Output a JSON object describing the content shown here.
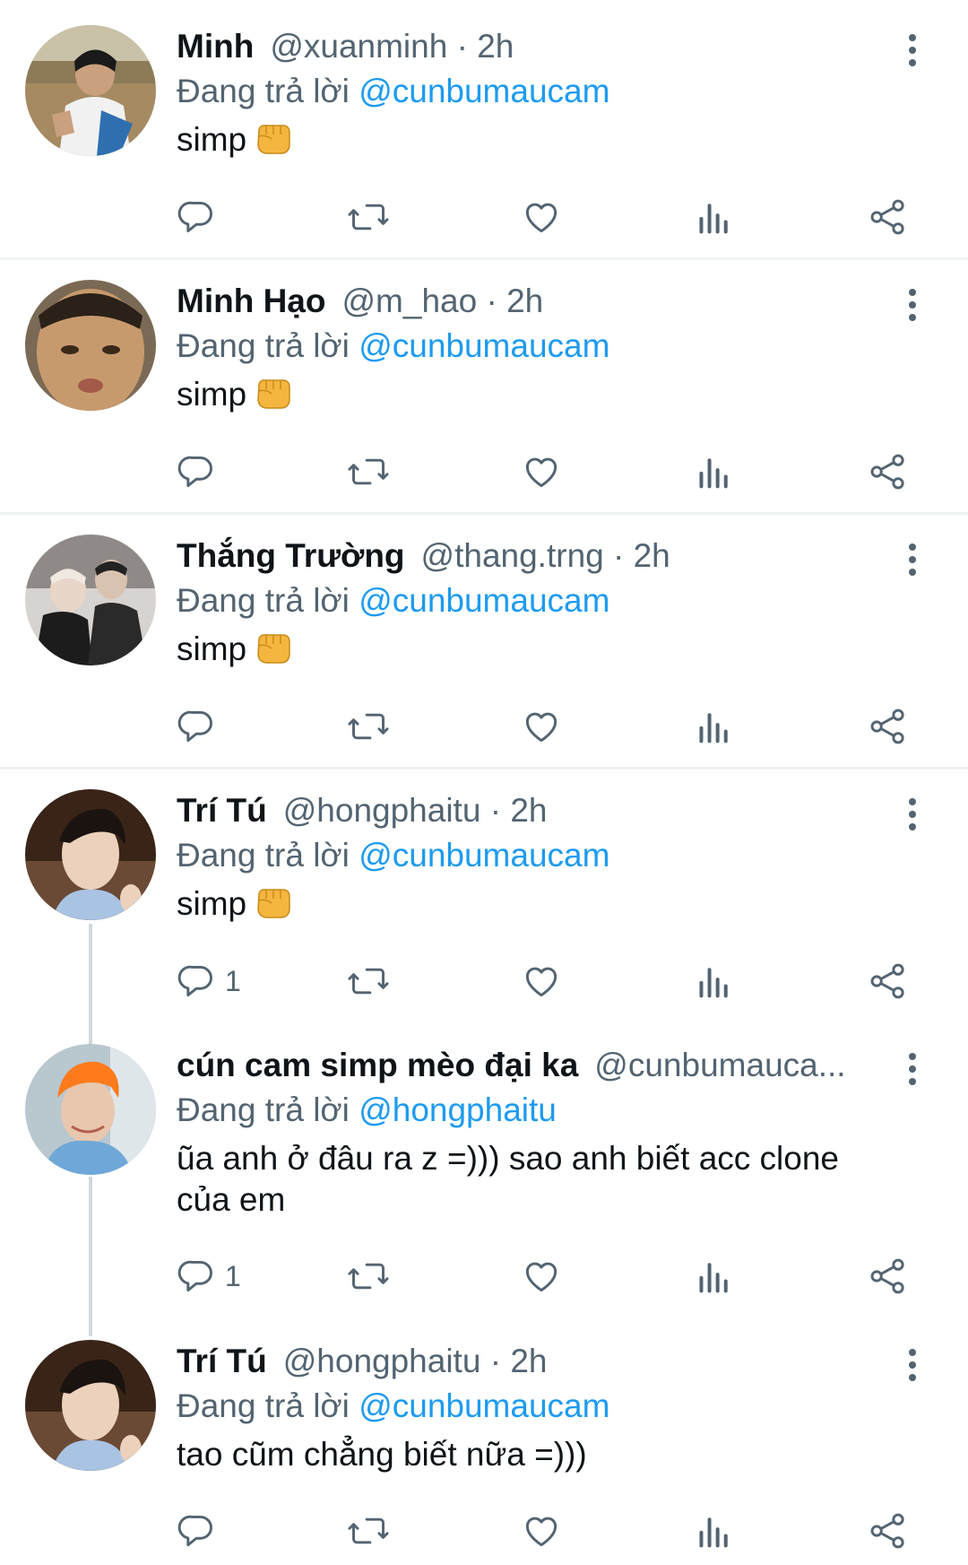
{
  "replying_prefix": "Đang trả lời",
  "accent_color": "#1d9bf0",
  "tweets": [
    {
      "name": "Minh",
      "handle": "@xuanminh",
      "separator": "·",
      "time": "2h",
      "reply_to": "@cunbumaucam",
      "text": "simp",
      "emoji": "fist-bump-emoji",
      "reply_count": "",
      "avatar": "avatar-photo-boy-field"
    },
    {
      "name": "Minh Hạo",
      "handle": "@m_hao",
      "separator": "·",
      "time": "2h",
      "reply_to": "@cunbumaucam",
      "text": "simp",
      "emoji": "fist-bump-emoji",
      "reply_count": "",
      "avatar": "avatar-photo-child-face"
    },
    {
      "name": "Thắng Trường",
      "handle": "@thang.trng",
      "separator": "·",
      "time": "2h",
      "reply_to": "@cunbumaucam",
      "text": "simp",
      "emoji": "fist-bump-emoji",
      "reply_count": "",
      "avatar": "avatar-photo-two-men"
    },
    {
      "name": "Trí Tú",
      "handle": "@hongphaitu",
      "separator": "·",
      "time": "2h",
      "reply_to": "@cunbumaucam",
      "text": "simp",
      "emoji": "fist-bump-emoji",
      "reply_count": "1",
      "avatar": "avatar-photo-young-man"
    },
    {
      "name": "cún cam simp mèo đại ka",
      "handle": "@cunbumauca...",
      "separator": "",
      "time": "",
      "reply_to": "@hongphaitu",
      "text": "ũa anh ở đâu ra z =))) sao anh biết acc clone của em",
      "emoji": "",
      "reply_count": "1",
      "avatar": "avatar-photo-orange-hair"
    },
    {
      "name": "Trí Tú",
      "handle": "@hongphaitu",
      "separator": "·",
      "time": "2h",
      "reply_to": "@cunbumaucam",
      "text": "tao cũm chẳng biết nữa =)))",
      "emoji": "",
      "reply_count": "",
      "avatar": "avatar-photo-young-man"
    }
  ]
}
